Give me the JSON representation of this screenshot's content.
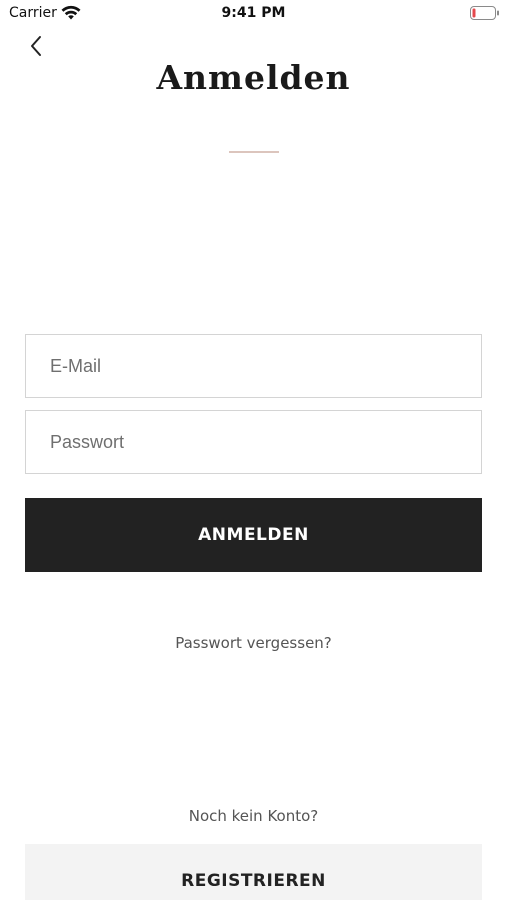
{
  "status_bar": {
    "carrier": "Carrier",
    "time": "9:41 PM",
    "wifi_icon": "wifi-icon",
    "battery_icon": "battery-low-icon",
    "battery_color": "#e5484d"
  },
  "header": {
    "back_icon": "chevron-left-icon",
    "title": "Anmelden",
    "divider_color": "#dcc5bd"
  },
  "form": {
    "email_placeholder": "E-Mail",
    "email_value": "",
    "password_placeholder": "Passwort",
    "password_value": "",
    "login_label": "ANMELDEN",
    "login_color": "#222222",
    "forgot_label": "Passwort vergessen?"
  },
  "footer": {
    "no_account_label": "Noch kein Konto?",
    "register_label": "REGISTRIEREN"
  }
}
